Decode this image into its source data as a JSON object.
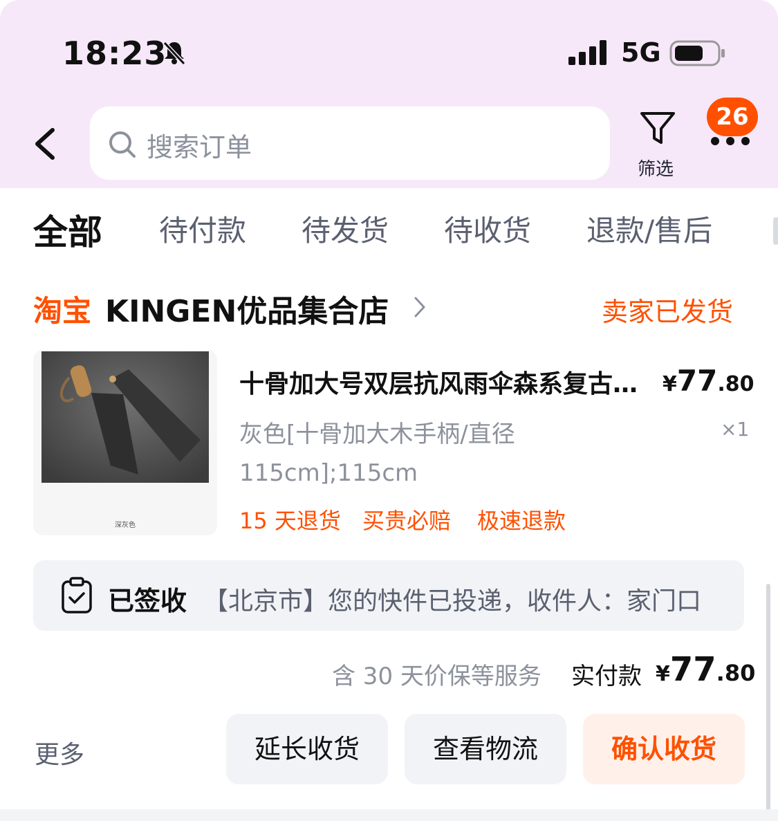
{
  "status_bar": {
    "time": "18:23",
    "network": "5G"
  },
  "header": {
    "search_placeholder": "搜索订单",
    "filter_label": "筛选",
    "badge_count": "26"
  },
  "tabs": [
    {
      "label": "全部",
      "active": true
    },
    {
      "label": "待付款",
      "active": false
    },
    {
      "label": "待发货",
      "active": false
    },
    {
      "label": "待收货",
      "active": false
    },
    {
      "label": "退款/售后",
      "active": false
    }
  ],
  "order": {
    "shop_logo": "淘宝",
    "shop_name": "KINGEN优品集合店",
    "status": "卖家已发货",
    "product": {
      "title": "十骨加大号双层抗风雨伞森系复古复古",
      "price_currency": "¥",
      "price_int": "77",
      "price_dec": ".80",
      "sku_line1": "灰色[十骨加大木手柄/直径",
      "sku_line2": "115cm];115cm",
      "quantity": "×1",
      "image_caption": "深灰色",
      "promos": [
        "15 天退货",
        "买贵必赔",
        "极速退款"
      ]
    },
    "logistics": {
      "status": "已签收",
      "detail": "【北京市】您的快件已投递，收件人：家门口"
    },
    "service_note": "含 30 天价保等服务",
    "paid_label": "实付款",
    "paid_currency": "¥",
    "paid_int": "77",
    "paid_dec": ".80",
    "actions": {
      "more": "更多",
      "extend": "延长收货",
      "track": "查看物流",
      "confirm": "确认收货"
    }
  },
  "colors": {
    "accent": "#ff5000",
    "header_bg": "#f7e8f9",
    "card_bg": "#f1f3f6"
  }
}
